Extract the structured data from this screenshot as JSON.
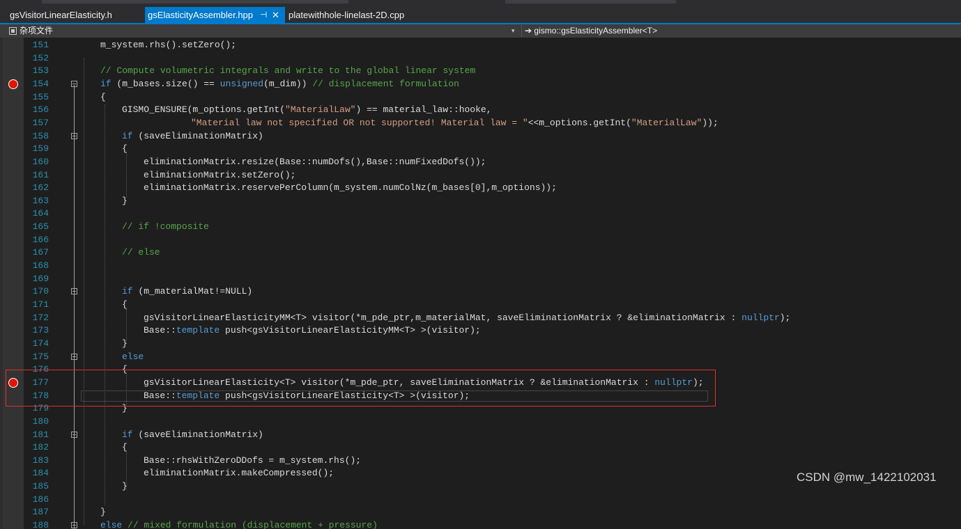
{
  "tabs": [
    {
      "label": "gsVisitorLinearElasticity.h",
      "active": false
    },
    {
      "label": "gsElasticityAssembler.hpp",
      "active": true,
      "pin": "⊣",
      "close": "✕"
    },
    {
      "label": "platewithhole-linelast-2D.cpp",
      "active": false
    }
  ],
  "navbar": {
    "project": "杂项文件",
    "scope_arrow": "➔",
    "scope": "gismo::gsElasticityAssembler<T>",
    "dropdown_glyph": "▾"
  },
  "lines": [
    {
      "n": "151",
      "code": "m_system.rhs().setZero();"
    },
    {
      "n": "152",
      "code": ""
    },
    {
      "n": "153",
      "code": "// Compute volumetric integrals and write to the global linear system"
    },
    {
      "n": "154",
      "code": "if (m_bases.size() == unsigned(m_dim)) // displacement formulation"
    },
    {
      "n": "155",
      "code": "{"
    },
    {
      "n": "156",
      "code": "GISMO_ENSURE(m_options.getInt(\"MaterialLaw\") == material_law::hooke,"
    },
    {
      "n": "157",
      "code": "\"Material law not specified OR not supported! Material law = \"<<m_options.getInt(\"MaterialLaw\"));"
    },
    {
      "n": "158",
      "code": "if (saveEliminationMatrix)"
    },
    {
      "n": "159",
      "code": "{"
    },
    {
      "n": "160",
      "code": "eliminationMatrix.resize(Base::numDofs(),Base::numFixedDofs());"
    },
    {
      "n": "161",
      "code": "eliminationMatrix.setZero();"
    },
    {
      "n": "162",
      "code": "eliminationMatrix.reservePerColumn(m_system.numColNz(m_bases[0],m_options));"
    },
    {
      "n": "163",
      "code": "}"
    },
    {
      "n": "164",
      "code": ""
    },
    {
      "n": "165",
      "code": "// if !composite"
    },
    {
      "n": "166",
      "code": ""
    },
    {
      "n": "167",
      "code": "// else"
    },
    {
      "n": "168",
      "code": ""
    },
    {
      "n": "169",
      "code": ""
    },
    {
      "n": "170",
      "code": "if (m_materialMat!=NULL)"
    },
    {
      "n": "171",
      "code": "{"
    },
    {
      "n": "172",
      "code": "gsVisitorLinearElasticityMM<T> visitor(*m_pde_ptr,m_materialMat, saveEliminationMatrix ? &eliminationMatrix : nullptr);"
    },
    {
      "n": "173",
      "code": "Base::template push<gsVisitorLinearElasticityMM<T> >(visitor);"
    },
    {
      "n": "174",
      "code": "}"
    },
    {
      "n": "175",
      "code": "else"
    },
    {
      "n": "176",
      "code": "{"
    },
    {
      "n": "177",
      "code": "gsVisitorLinearElasticity<T> visitor(*m_pde_ptr, saveEliminationMatrix ? &eliminationMatrix : nullptr);"
    },
    {
      "n": "178",
      "code": "Base::template push<gsVisitorLinearElasticity<T> >(visitor);"
    },
    {
      "n": "179",
      "code": "}"
    },
    {
      "n": "180",
      "code": ""
    },
    {
      "n": "181",
      "code": "if (saveEliminationMatrix)"
    },
    {
      "n": "182",
      "code": "{"
    },
    {
      "n": "183",
      "code": "Base::rhsWithZeroDDofs = m_system.rhs();"
    },
    {
      "n": "184",
      "code": "eliminationMatrix.makeCompressed();"
    },
    {
      "n": "185",
      "code": "}"
    },
    {
      "n": "186",
      "code": ""
    },
    {
      "n": "187",
      "code": "}"
    },
    {
      "n": "188",
      "code": "else // mixed formulation (displacement + pressure)"
    }
  ],
  "breakpoints": [
    "154",
    "177"
  ],
  "watermark": "CSDN @mw_1422102031",
  "colors": {
    "accent": "#007acc",
    "keyword": "#569cd6",
    "comment": "#57a64a",
    "string": "#d69d85",
    "line_number": "#2b91af",
    "breakpoint": "#e51400",
    "highlight_box": "#e03030"
  }
}
